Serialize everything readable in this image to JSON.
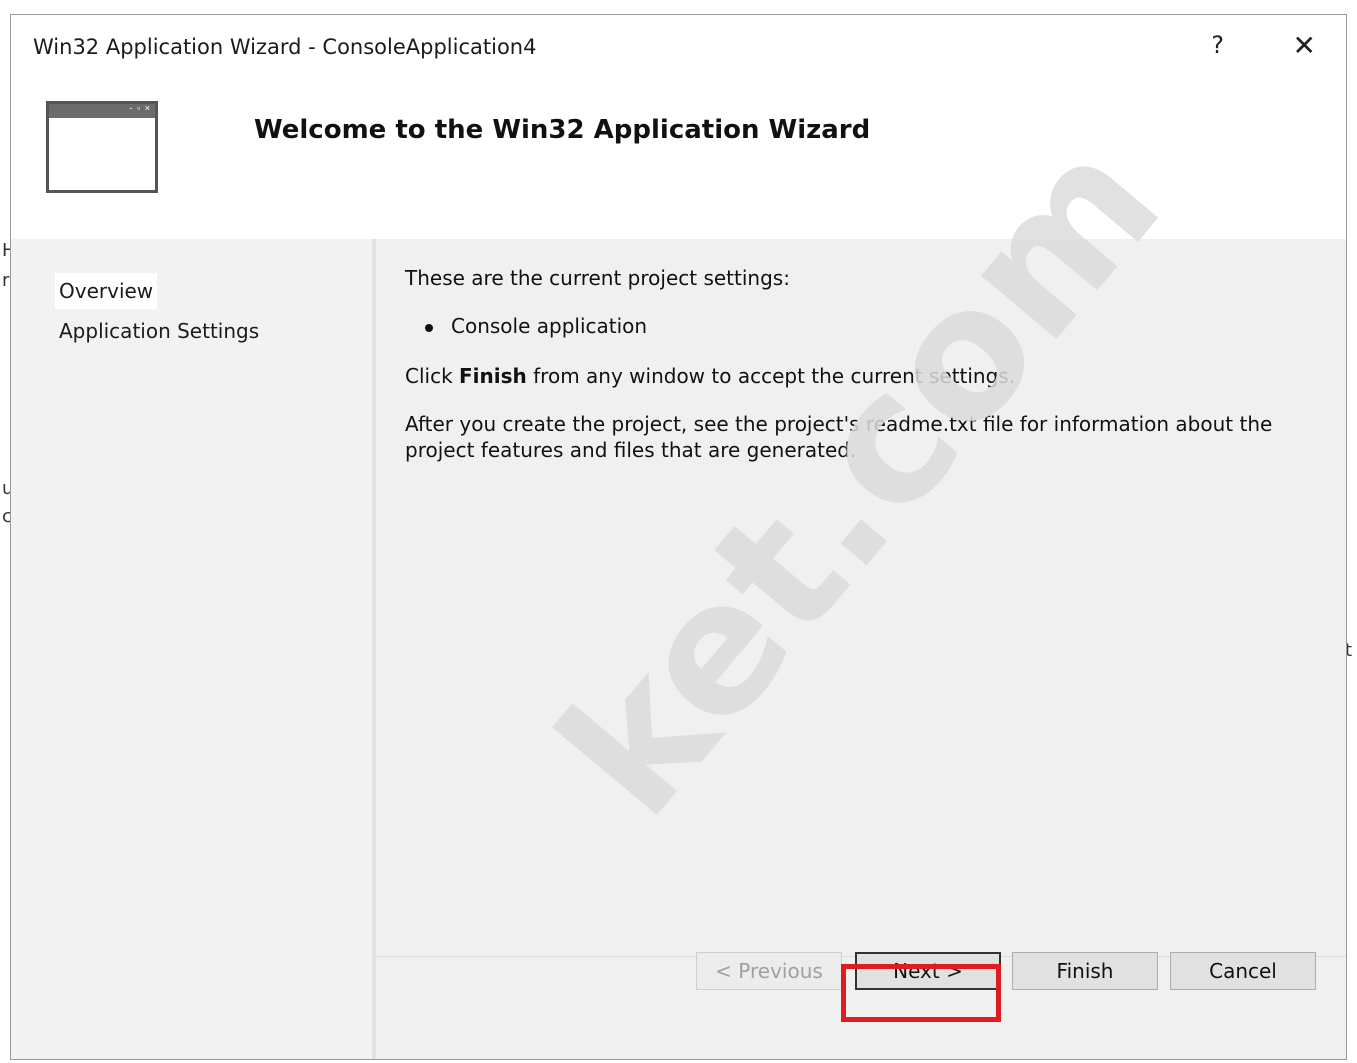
{
  "window": {
    "title": "Win32 Application Wizard - ConsoleApplication4",
    "help_glyph": "?",
    "close_glyph": "✕"
  },
  "header": {
    "heading": "Welcome to the Win32 Application Wizard",
    "icon_controls": "- ▫ ×"
  },
  "nav": {
    "items": [
      {
        "label": "Overview",
        "selected": true
      },
      {
        "label": "Application Settings",
        "selected": false
      }
    ]
  },
  "content": {
    "intro": "These are the current project settings:",
    "bullet": "Console application",
    "click_prefix": "Click ",
    "click_bold": "Finish",
    "click_suffix": " from any window to accept the current settings.",
    "readme_note": "After you create the project, see the project's readme.txt file for information about the project features and files that are generated."
  },
  "buttons": {
    "previous": "< Previous",
    "next": "Next >",
    "finish": "Finish",
    "cancel": "Cancel"
  },
  "watermark": "ket.com"
}
